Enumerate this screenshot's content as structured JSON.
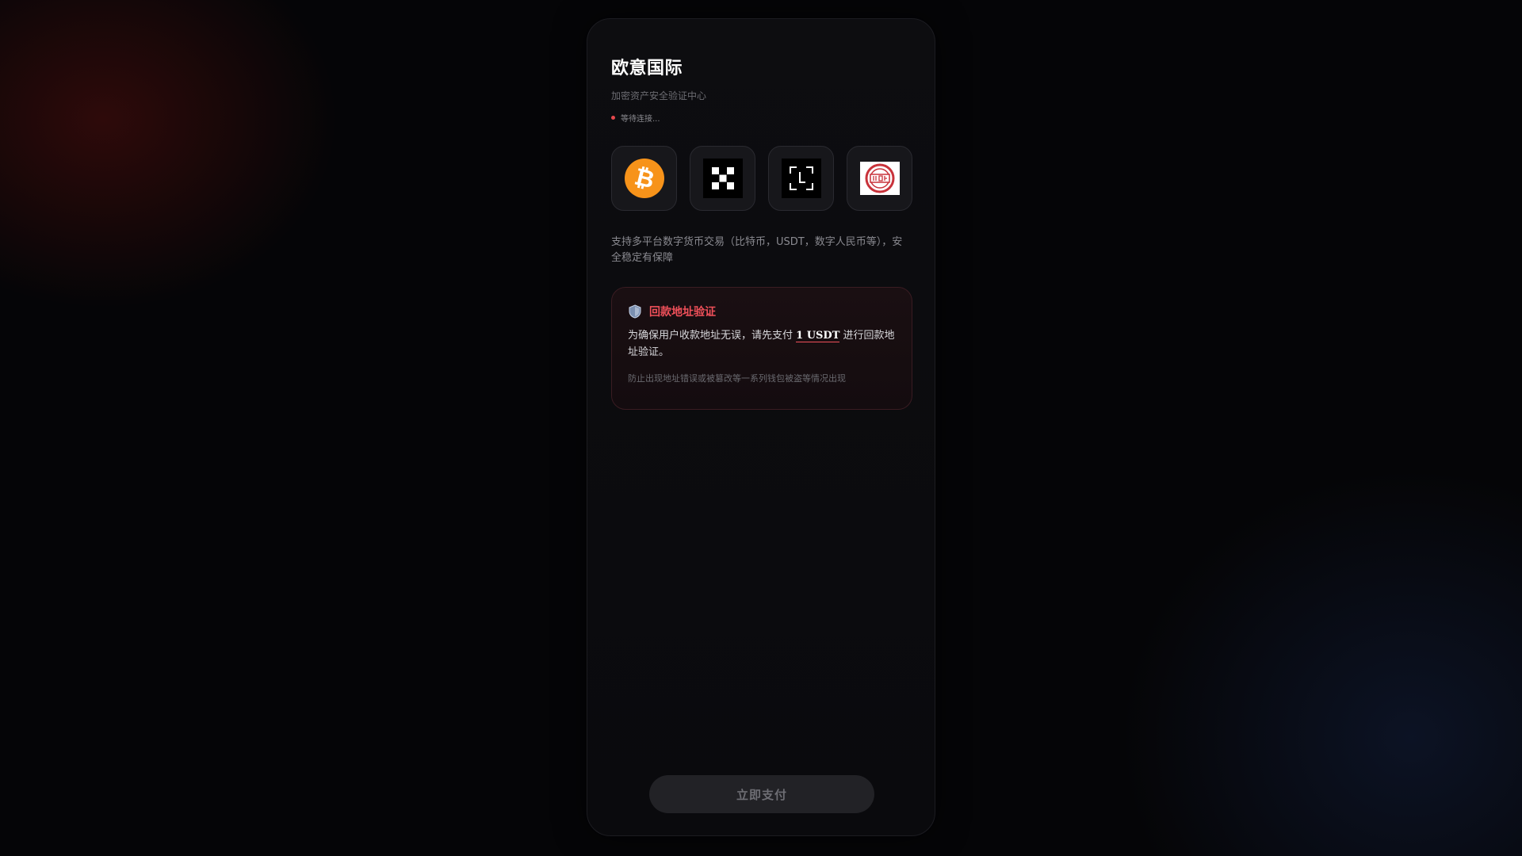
{
  "header": {
    "title": "欧意国际",
    "subtitle": "加密资产安全验证中心",
    "status_text": "等待连接..."
  },
  "logos": [
    {
      "name": "bitcoin",
      "icon": "bitcoin-icon",
      "color": "#f7931a"
    },
    {
      "name": "okx",
      "icon": "okx-icon",
      "color": "#000000"
    },
    {
      "name": "scan",
      "icon": "scan-frame-icon",
      "color": "#000000"
    },
    {
      "name": "huobi-seal",
      "icon": "red-seal-icon",
      "color": "#c8323a"
    }
  ],
  "description": "支持多平台数字货币交易（比特币，USDT，数字人民币等），安全稳定有保障",
  "verify": {
    "title": "回款地址验证",
    "text_before": "为确保用户收款地址无误，请先支付 ",
    "amount": "1 USDT",
    "text_after": " 进行回款地址验证。",
    "note": "防止出现地址错误或被篡改等一系列钱包被盗等情况出现",
    "icon": "shield-icon"
  },
  "actions": {
    "pay_label": "立即支付"
  },
  "colors": {
    "accent_red": "#f0505a",
    "status_dot": "#e5484d",
    "bitcoin_orange": "#f7931a"
  }
}
